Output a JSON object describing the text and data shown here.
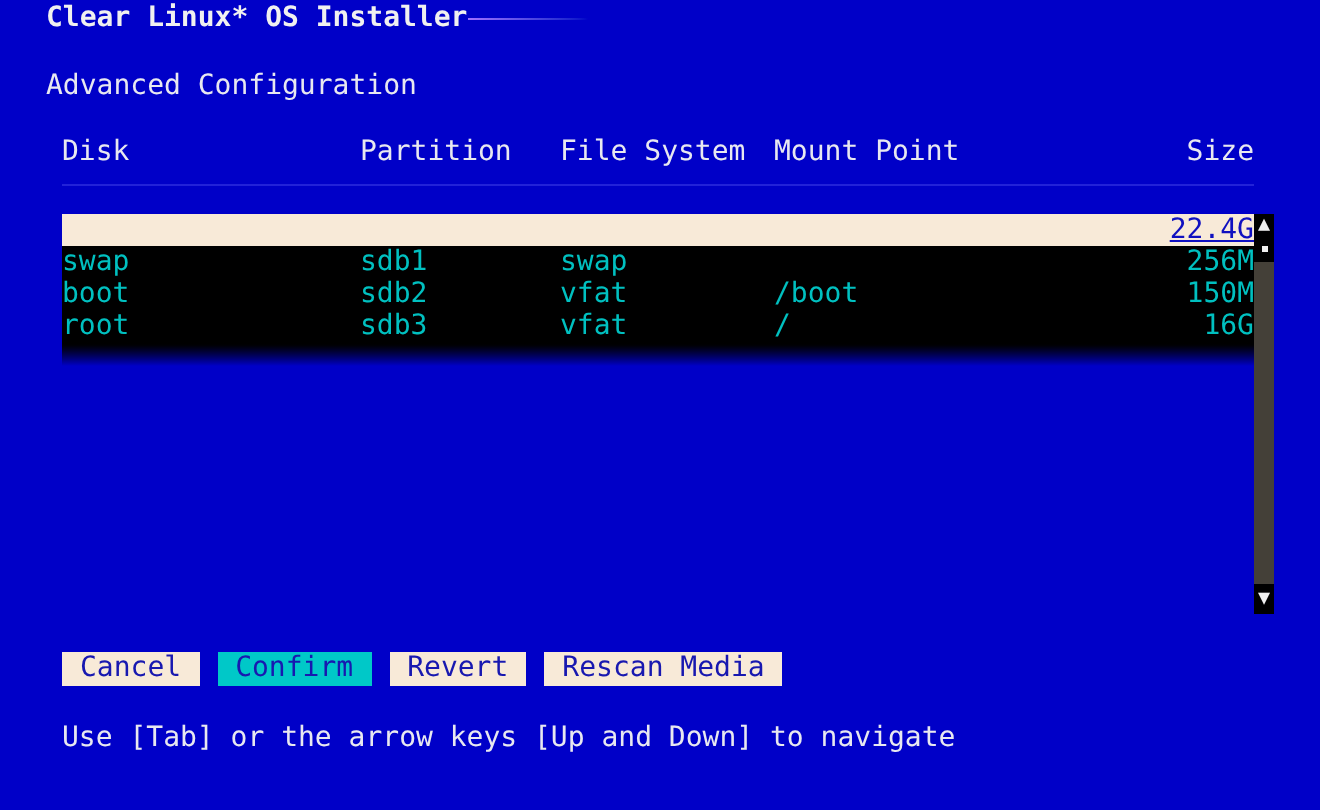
{
  "window": {
    "title": "Clear Linux* OS Installer"
  },
  "heading": "Advanced Configuration",
  "table": {
    "columns": [
      "Disk",
      "Partition",
      "File System",
      "Mount Point",
      "Size"
    ],
    "rows": [
      {
        "size": "22.4G",
        "selected": true
      },
      {
        "disk": "swap",
        "partition": "sdb1",
        "file_system": "swap",
        "size": "256M",
        "selected": false
      },
      {
        "disk": "boot",
        "partition": "sdb2",
        "file_system": "vfat",
        "mount_point": "/boot",
        "size": "150M",
        "selected": false
      },
      {
        "disk": "root",
        "partition": "sdb3",
        "file_system": "vfat",
        "mount_point": "/",
        "size": "16G",
        "selected": false
      }
    ]
  },
  "scrollbar": {
    "up": "▲",
    "down": "▼"
  },
  "buttons": [
    {
      "label": "Cancel",
      "selected": false
    },
    {
      "label": "Confirm",
      "selected": true
    },
    {
      "label": "Revert",
      "selected": false
    },
    {
      "label": "Rescan Media",
      "selected": false
    }
  ],
  "help": "Use [Tab] or the arrow keys [Up and Down] to navigate"
}
